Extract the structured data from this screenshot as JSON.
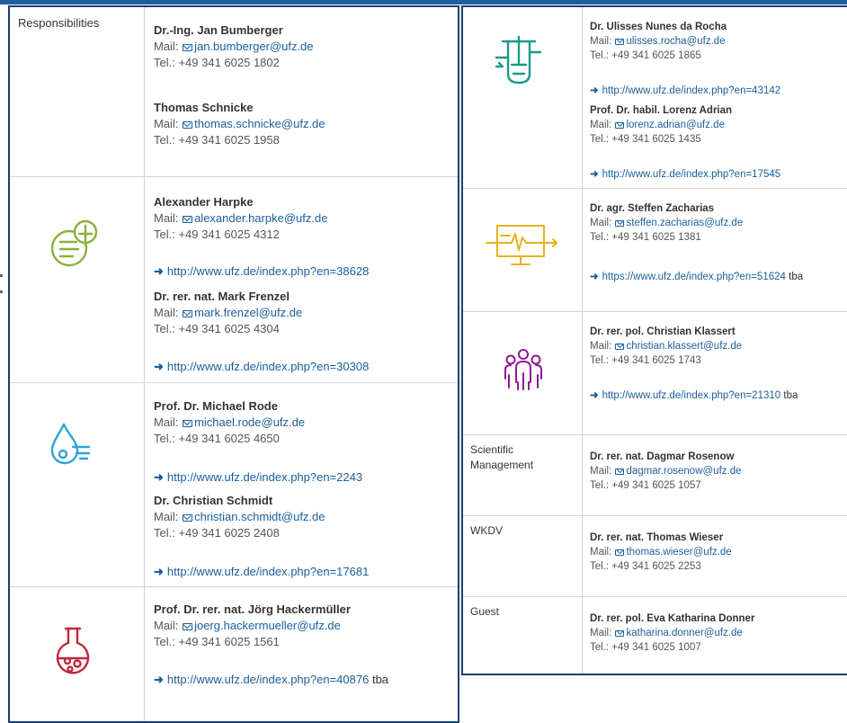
{
  "colors": {
    "frame": "#1b3e6e",
    "link": "#1a5e9a",
    "green": "#8ab03a",
    "blue": "#31a2d8",
    "red": "#c0263a",
    "teal": "#1a9a8a",
    "yellow": "#e8b21a",
    "purple": "#8b1a96"
  },
  "left": {
    "rows": [
      {
        "label": "Responsibilities",
        "icon": "",
        "people": [
          {
            "name": "Dr.-Ing. Jan Bumberger",
            "mail_prefix": "Mail:",
            "mail": "jan.bumberger@ufz.de",
            "tel": "Tel.: +49 341 6025 1802",
            "link": "",
            "tba": ""
          },
          {
            "name": "Thomas Schnicke",
            "mail_prefix": "Mail:",
            "mail": "thomas.schnicke@ufz.de",
            "tel": "Tel.: +49 341 6025 1958",
            "link": "",
            "tba": ""
          }
        ]
      },
      {
        "label": "",
        "icon": "green-document-icon",
        "people": [
          {
            "name": "Alexander Harpke",
            "mail_prefix": "Mail:",
            "mail": "alexander.harpke@ufz.de",
            "tel": "Tel.: +49 341 6025 4312",
            "link": "http://www.ufz.de/index.php?en=38628",
            "tba": ""
          },
          {
            "name": "Dr. rer. nat. Mark Frenzel",
            "mail_prefix": "Mail:",
            "mail": "mark.frenzel@ufz.de",
            "tel": "Tel.: +49 341 6025 4304",
            "link": "http://www.ufz.de/index.php?en=30308",
            "tba": ""
          }
        ]
      },
      {
        "label": "",
        "icon": "water-drop-icon",
        "people": [
          {
            "name": "Prof. Dr. Michael Rode",
            "mail_prefix": "Mail:",
            "mail": "michael.rode@ufz.de",
            "tel": "Tel.: +49 341 6025 4650",
            "link": "http://www.ufz.de/index.php?en=2243",
            "tba": ""
          },
          {
            "name": "Dr. Christian Schmidt",
            "mail_prefix": "Mail:",
            "mail": "christian.schmidt@ufz.de",
            "tel": "Tel.: +49 341 6025 2408",
            "link": "http://www.ufz.de/index.php?en=17681",
            "tba": ""
          }
        ]
      },
      {
        "label": "",
        "icon": "flask-icon",
        "people": [
          {
            "name": "Prof. Dr. rer. nat. Jörg Hackermüller",
            "mail_prefix": "Mail:",
            "mail": "joerg.hackermueller@ufz.de",
            "tel": "Tel.: +49 341 6025 1561",
            "link": "http://www.ufz.de/index.php?en=40876",
            "tba": "tba"
          }
        ]
      }
    ]
  },
  "right": {
    "rows": [
      {
        "label": "",
        "icon": "reactor-icon",
        "people": [
          {
            "name": "Dr. Ulisses Nunes da Rocha",
            "mail_prefix": "Mail:",
            "mail": "ulisses.rocha@ufz.de",
            "tel": "Tel.: +49 341 6025 1865",
            "link": "http://www.ufz.de/index.php?en=43142",
            "tba": ""
          },
          {
            "name": "Prof. Dr. habil. Lorenz Adrian",
            "mail_prefix": "Mail:",
            "mail": "lorenz.adrian@ufz.de",
            "tel": "Tel.: +49 341 6025 1435",
            "link": "http://www.ufz.de/index.php?en=17545",
            "tba": ""
          }
        ]
      },
      {
        "label": "",
        "icon": "monitor-pulse-icon",
        "people": [
          {
            "name": "Dr. agr. Steffen Zacharias",
            "mail_prefix": "Mail:",
            "mail": "steffen.zacharias@ufz.de",
            "tel": "Tel.: +49 341 6025 1381",
            "link": "https://www.ufz.de/index.php?en=51624",
            "tba": "tba"
          }
        ]
      },
      {
        "label": "",
        "icon": "people-group-icon",
        "people": [
          {
            "name": "Dr. rer. pol. Christian Klassert",
            "mail_prefix": "Mail:",
            "mail": "christian.klassert@ufz.de",
            "tel": "Tel.: +49 341 6025 1743",
            "link": "http://www.ufz.de/index.php?en=21310",
            "tba": "tba"
          }
        ]
      },
      {
        "label": "Scientific Management",
        "icon": "",
        "people": [
          {
            "name": "Dr. rer. nat. Dagmar Rosenow",
            "mail_prefix": "Mail:",
            "mail": "dagmar.rosenow@ufz.de",
            "tel": "Tel.: +49 341 6025 1057",
            "link": "",
            "tba": ""
          }
        ]
      },
      {
        "label": "WKDV",
        "icon": "",
        "people": [
          {
            "name": "Dr. rer. nat. Thomas Wieser",
            "mail_prefix": "Mail:",
            "mail": "thomas.wieser@ufz.de",
            "tel": "Tel.: +49 341 6025 2253",
            "link": "",
            "tba": ""
          }
        ]
      },
      {
        "label": "Guest",
        "icon": "",
        "people": [
          {
            "name": "Dr. rer. pol. Eva Katharina Donner",
            "mail_prefix": "Mail:",
            "mail": "katharina.donner@ufz.de",
            "tel": "Tel.: +49 341 6025 1007",
            "link": "",
            "tba": ""
          }
        ]
      }
    ]
  }
}
